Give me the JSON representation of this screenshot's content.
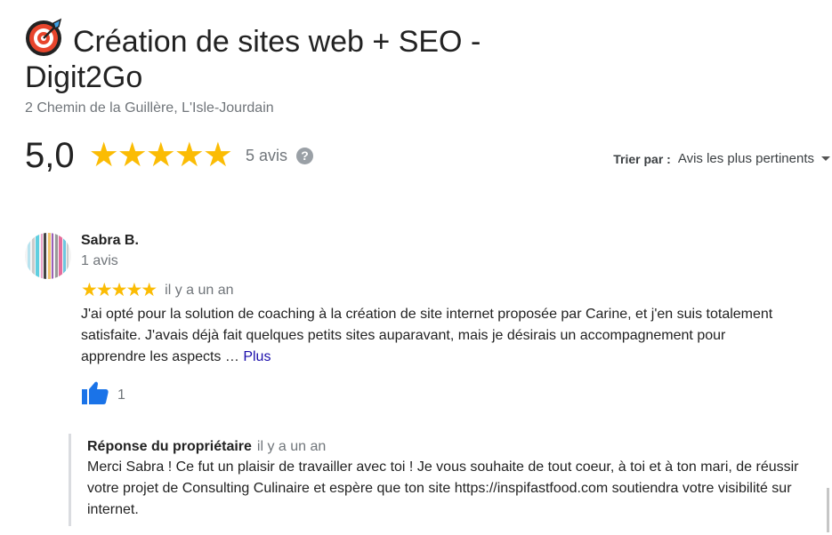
{
  "header": {
    "title": "Création de sites web + SEO - Digit2Go",
    "address": "2 Chemin de la Guillère, L'Isle-Jourdain"
  },
  "rating": {
    "value": "5,0",
    "stars": "★★★★★",
    "stars_count": 5,
    "reviews_count": "5 avis",
    "help_icon": "?"
  },
  "sort": {
    "label": "Trier par :",
    "value": "Avis les plus pertinents"
  },
  "review": {
    "author": "Sabra B.",
    "author_reviews": "1 avis",
    "stars": "★★★★★",
    "date": "il y a un an",
    "text": "J'ai opté pour la solution de coaching à la création de site internet proposée par Carine, et j'en suis totalement satisfaite. J'avais déjà fait quelques petits sites auparavant, mais je désirais un accompagnement pour apprendre les aspects … ",
    "more": "Plus",
    "likes": "1"
  },
  "owner_reply": {
    "label": "Réponse du propriétaire",
    "date": "il y a un an",
    "text": "Merci Sabra ! Ce fut un plaisir de travailler avec toi ! Je vous souhaite de tout coeur, à toi et à ton mari, de réussir votre projet de Consulting Culinaire et espère que ton site https://inspifastfood.com soutiendra votre visibilité sur internet."
  },
  "colors": {
    "star": "#fbbc04",
    "link": "#1a0dab",
    "thumb": "#1a73e8",
    "muted": "#70757a"
  },
  "icons": [
    "target-logo-icon",
    "help-icon",
    "caret-down-icon",
    "thumbs-up-icon"
  ]
}
